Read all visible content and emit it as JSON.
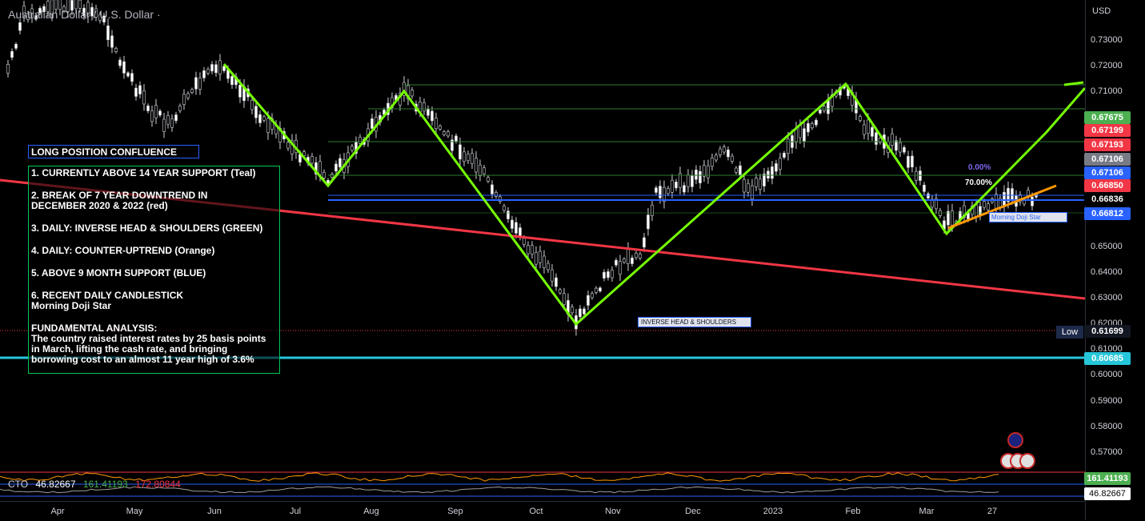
{
  "header": {
    "title": "Australian Dollar / U.S. Dollar ·"
  },
  "price_axis": {
    "currency": "USD",
    "ticks": [
      "0.73000",
      "0.72000",
      "0.71000",
      "0.65000",
      "0.64000",
      "0.63000",
      "0.62000",
      "0.61000",
      "0.60000",
      "0.59000",
      "0.58000",
      "0.57000"
    ],
    "tags": [
      {
        "value": "0.67675",
        "color": "#4caf50"
      },
      {
        "value": "0.67199",
        "color": "#f23645"
      },
      {
        "value": "0.67193",
        "color": "#f23645"
      },
      {
        "value": "0.67106",
        "color": "#787b86"
      },
      {
        "value": "0.67106",
        "color": "#2962ff"
      },
      {
        "value": "0.66850",
        "color": "#f23645"
      },
      {
        "value": "0.66836",
        "color": "#000000"
      },
      {
        "value": "0.66812",
        "color": "#2962ff"
      },
      {
        "value": "0.61699",
        "color": "#131722"
      },
      {
        "value": "0.60685",
        "color": "#26c6da"
      },
      {
        "value": "161.41193",
        "color": "#4caf50"
      },
      {
        "value": "46.82667",
        "color": "#ffffff"
      }
    ],
    "low_label": "Low"
  },
  "time_axis": {
    "months": [
      "Apr",
      "May",
      "Jun",
      "Jul",
      "Aug",
      "Sep",
      "Oct",
      "Nov",
      "Dec",
      "2023",
      "Feb",
      "Mar",
      "27"
    ]
  },
  "annotations": {
    "header_box": "LONG POSITION CONFLUENCE",
    "items": [
      "1. CURRENTLY ABOVE 14 YEAR SUPPORT (Teal)",
      "2. BREAK OF 7 YEAR DOWNTREND IN\nDECEMBER 2020 & 2022  (red)",
      "3. DAILY: INVERSE HEAD & SHOULDERS (GREEN)",
      "4. DAILY: COUNTER-UPTREND (Orange)",
      "5. ABOVE 9 MONTH SUPPORT (BLUE)",
      "6. RECENT DAILY CANDLESTICK\nMorning Doji Star",
      "FUNDAMENTAL ANALYSIS:\nThe country raised interest rates by 25 basis points\nin March, lifting the cash rate, and bringing\nborrowing cost to an almost 11 year high of 3.6%"
    ],
    "ihs_label": "INVERSE HEAD & SHOULDERS",
    "mds_label": "Morning Doji Star",
    "fib_a": "0.00%",
    "fib_b": "70.00%"
  },
  "indicator": {
    "name": "CTO",
    "v1": "46.82667",
    "v2": "161.41193",
    "v3": "172.80844"
  },
  "colors": {
    "green": "#76ff03",
    "red": "#f23645",
    "teal": "#26c6da",
    "blue": "#2962ff",
    "orange": "#ff9800"
  }
}
